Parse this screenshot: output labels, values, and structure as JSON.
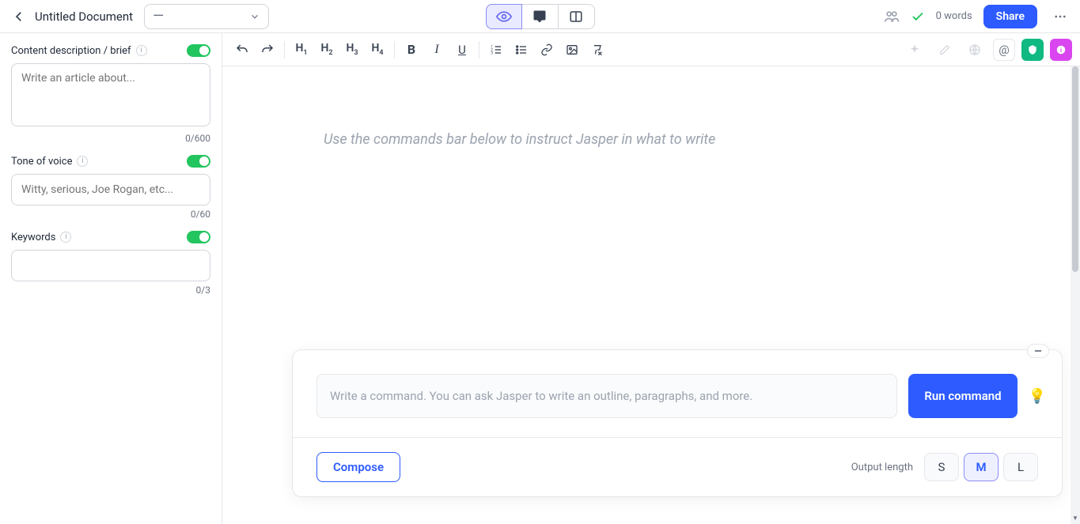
{
  "header": {
    "title": "Untitled Document",
    "template_display": "—",
    "word_count": "0 words",
    "share_label": "Share"
  },
  "sidebar": {
    "brief": {
      "label": "Content description / brief",
      "placeholder": "Write an article about...",
      "counter": "0/600"
    },
    "tone": {
      "label": "Tone of voice",
      "placeholder": "Witty, serious, Joe Rogan, etc...",
      "counter": "0/60"
    },
    "keywords": {
      "label": "Keywords",
      "counter": "0/3"
    }
  },
  "editor": {
    "placeholder": "Use the commands bar below to instruct Jasper in what to write"
  },
  "command": {
    "input_placeholder": "Write a command. You can ask Jasper to write an outline, paragraphs, and more.",
    "run_label": "Run command",
    "compose_label": "Compose",
    "output_length_label": "Output length",
    "lengths": {
      "s": "S",
      "m": "M",
      "l": "L"
    }
  },
  "icons": {
    "bulb": "💡"
  }
}
